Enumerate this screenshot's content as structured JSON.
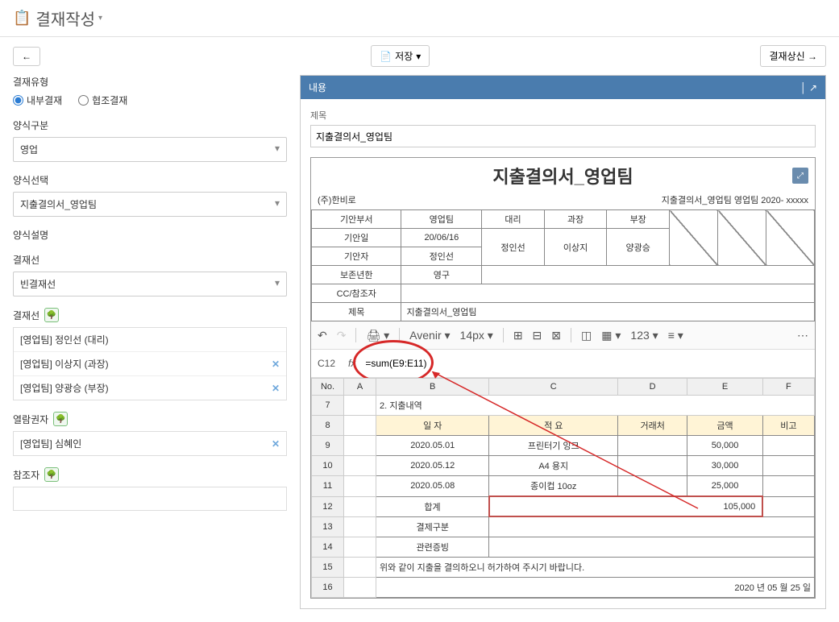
{
  "header": {
    "title": "결재작성"
  },
  "toolbar": {
    "back": "←",
    "save": "저장",
    "submit": "결재상신 →"
  },
  "sidebar": {
    "approval_type_label": "결재유형",
    "radio_internal": "내부결재",
    "radio_coop": "협조결재",
    "form_category_label": "양식구분",
    "form_category_value": "영업",
    "form_select_label": "양식선택",
    "form_select_value": "지출결의서_영업팀",
    "form_desc_label": "양식설명",
    "approval_line_label": "결재선",
    "approval_line_value": "빈결재선",
    "approvers_label": "결재선",
    "approvers": [
      {
        "text": "[영업팀] 정인선 (대리)",
        "removable": false
      },
      {
        "text": "[영업팀] 이상지 (과장)",
        "removable": true
      },
      {
        "text": "[영업팀] 양광승 (부장)",
        "removable": true
      }
    ],
    "viewers_label": "열람권자",
    "viewers": [
      {
        "text": "[영업팀] 심혜인",
        "removable": true
      }
    ],
    "refs_label": "참조자"
  },
  "content": {
    "panel_title": "내용",
    "title_label": "제목",
    "title_value": "지출결의서_영업팀",
    "doc": {
      "title": "지출결의서_영업팀",
      "company": "(주)한비로",
      "docno": "지출결의서_영업팀 영업팀 2020- xxxxx",
      "info": {
        "dept_label": "기안부서",
        "dept": "영업팀",
        "roles": [
          "대리",
          "과장",
          "부장"
        ],
        "names": [
          "정인선",
          "이상지",
          "양광승"
        ],
        "date_label": "기안일",
        "date": "20/06/16",
        "drafter_label": "기안자",
        "drafter": "정인선",
        "retain_label": "보존년한",
        "retain": "영구",
        "cc_label": "CC/참조자",
        "subj_label": "제목",
        "subj": "지출결의서_영업팀"
      }
    },
    "spreadsheet": {
      "font": "Avenir",
      "size": "14px",
      "cell_ref": "C12",
      "formula": "=sum(E9:E11)",
      "columns": [
        "No.",
        "A",
        "B",
        "C",
        "D",
        "E",
        "F"
      ],
      "section_title": "2. 지출내역",
      "headers": [
        "일 자",
        "적 요",
        "거래처",
        "금액",
        "비고"
      ],
      "rows": [
        {
          "no": "9",
          "date": "2020.05.01",
          "desc": "프린터기 잉크",
          "vendor": "",
          "amount": "50,000",
          "note": ""
        },
        {
          "no": "10",
          "date": "2020.05.12",
          "desc": "A4 용지",
          "vendor": "",
          "amount": "30,000",
          "note": ""
        },
        {
          "no": "11",
          "date": "2020.05.08",
          "desc": "종이컵 10oz",
          "vendor": "",
          "amount": "25,000",
          "note": ""
        }
      ],
      "total_label": "합계",
      "total_value": "105,000",
      "payment_label": "결제구분",
      "receipt_label": "관련증빙",
      "note_text": "위와 같이 지출을 결의하오니 허가하여 주시기 바랍니다.",
      "footer_date": "2020  년   05 월  25  일"
    }
  },
  "chart_data": {
    "type": "table",
    "title": "지출내역",
    "columns": [
      "일자",
      "적요",
      "거래처",
      "금액",
      "비고"
    ],
    "rows": [
      [
        "2020.05.01",
        "프린터기 잉크",
        "",
        50000,
        ""
      ],
      [
        "2020.05.12",
        "A4 용지",
        "",
        30000,
        ""
      ],
      [
        "2020.05.08",
        "종이컵 10oz",
        "",
        25000,
        ""
      ]
    ],
    "total": 105000,
    "formula": "=sum(E9:E11)"
  }
}
